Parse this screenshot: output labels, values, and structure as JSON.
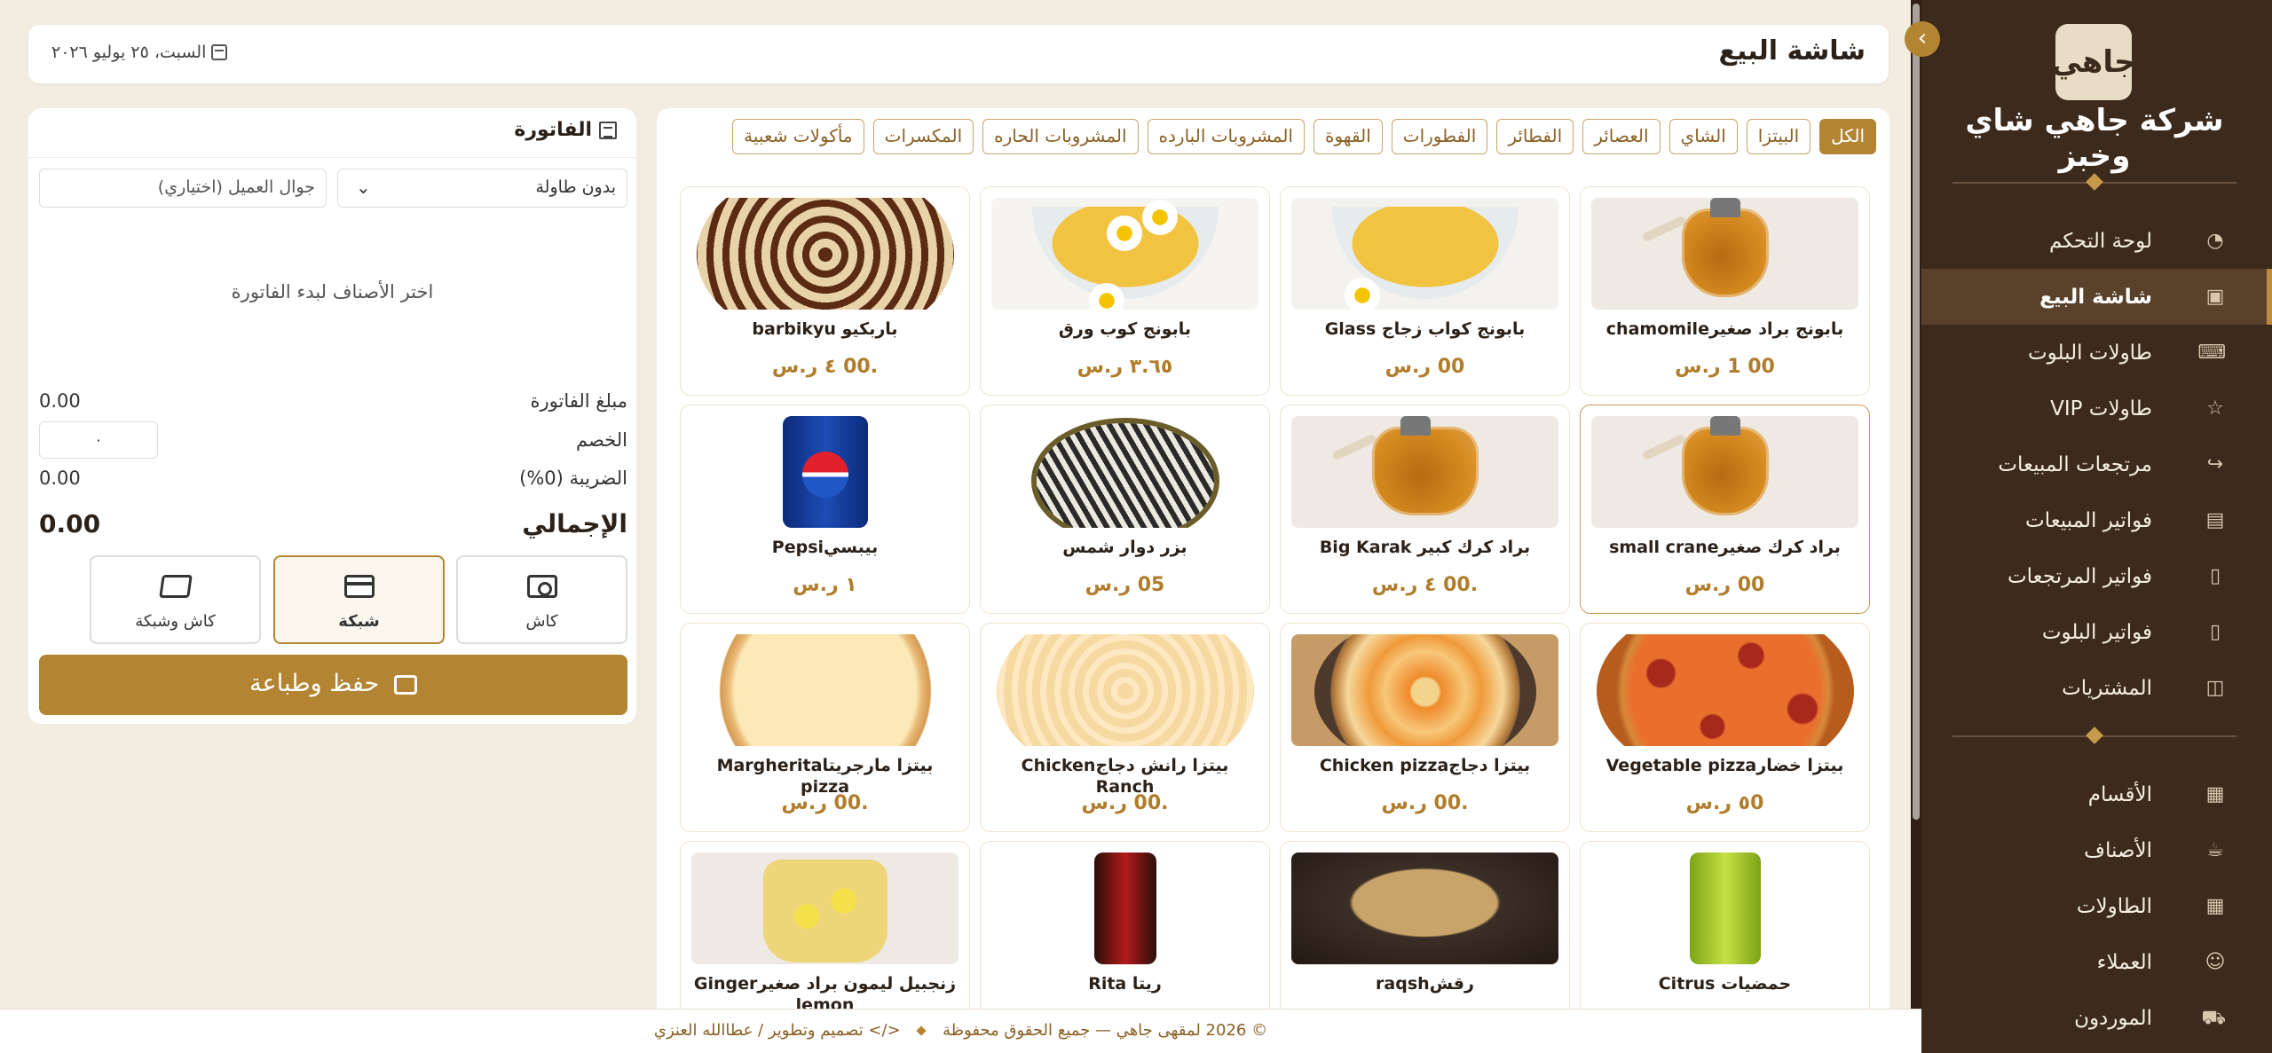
{
  "sidebar": {
    "logo_text": "جاهي",
    "company_name": "شركة جاهي شاي وخبز",
    "items": [
      {
        "label": "لوحة التحكم",
        "icon": "dashboard-gauge-icon"
      },
      {
        "label": "شاشة البيع",
        "icon": "pos-screen-icon",
        "active": true
      },
      {
        "label": "طاولات البلوت",
        "icon": "gamepad-icon"
      },
      {
        "label": "طاولات VIP",
        "icon": "star-icon"
      },
      {
        "label": "مرتجعات المبيعات",
        "icon": "return-arrow-icon"
      },
      {
        "label": "فواتير المبيعات",
        "icon": "invoice-icon"
      },
      {
        "label": "فواتير المرتجعات",
        "icon": "document-icon"
      },
      {
        "label": "فواتير البلوت",
        "icon": "document-list-icon"
      },
      {
        "label": "المشتريات",
        "icon": "shopping-bag-icon"
      }
    ],
    "items2": [
      {
        "label": "الأقسام",
        "icon": "grid-icon"
      },
      {
        "label": "الأصناف",
        "icon": "cup-icon"
      },
      {
        "label": "الطاولات",
        "icon": "tables-grid-icon"
      },
      {
        "label": "العملاء",
        "icon": "users-icon"
      },
      {
        "label": "الموردون",
        "icon": "truck-icon"
      }
    ]
  },
  "header": {
    "title": "شاشة البيع",
    "date": "السبت، ٢٥ يوليو ٢٠٢٦"
  },
  "categories": [
    "الكل",
    "البيتزا",
    "الشاي",
    "العصائر",
    "الفطائر",
    "الفطورات",
    "القهوة",
    "المشروبات البارده",
    "المشروبات الحاره",
    "المكسرات",
    "مأكولات شعبية"
  ],
  "active_category": "الكل",
  "products": [
    {
      "name": "بابونج براد صغيرchamomile",
      "price": "00   1 ر.س"
    },
    {
      "name": "بابونج كواب زجاج Glass",
      "price": "00   ر.س"
    },
    {
      "name": "بابونج كوب ورق",
      "price": "٣.٦٥ ر.س"
    },
    {
      "name": "باربكيو barbikyu",
      "price": ".00 ٤ ر.س"
    },
    {
      "name": "براد كرك صغيرsmall crane",
      "price": "00   ر.س"
    },
    {
      "name": "براد كرك كبير Big Karak",
      "price": ".00 ٤ ر.س"
    },
    {
      "name": "بزر دوار شمس",
      "price": "05   ر.س"
    },
    {
      "name": "بيبسيPepsi",
      "price": "١   ر.س"
    },
    {
      "name": "بيتزا خضارVegetable pizza",
      "price": "٥0   ر.س"
    },
    {
      "name": "بيتزا دجاجChicken pizza",
      "price": ".00   ر.س"
    },
    {
      "name": "بيتزا رانش دجاجChicken Ranch",
      "price": ".00   ر.س"
    },
    {
      "name": "بيتزا مارجريتاMargherita pizza",
      "price": ".00   ر.س"
    },
    {
      "name": "حمضيات Citrus",
      "price": ""
    },
    {
      "name": "رقشraqsh",
      "price": ""
    },
    {
      "name": "ريتا Rita",
      "price": ""
    },
    {
      "name": "زنجبيل ليمون براد صغيرGinger lemon",
      "price": ""
    }
  ],
  "invoice": {
    "title": "الفاتورة",
    "table_select": "بدون طاولة",
    "phone_placeholder": "جوال العميل (اختياري)",
    "empty_text": "اختر الأصناف لبدء الفاتورة",
    "subtotal_label": "مبلغ الفاتورة",
    "subtotal_value": "0.00",
    "discount_label": "الخصم",
    "discount_value": "٠",
    "tax_label": "الضريبة (0%)",
    "tax_value": "0.00",
    "total_label": "الإجمالي",
    "total_value": "0.00",
    "pay_cash": "كاش",
    "pay_card": "شبكة",
    "pay_mixed": "كاش وشبكة",
    "save_label": "حفظ وطباعة"
  },
  "footer": {
    "copyright": "© 2026 لمقهى جاهي — جميع الحقوق محفوظة",
    "credit": "</> تصميم وتطوير / عطاالله العنزي"
  },
  "colors": {
    "brand": "#b38432",
    "sidebar": "#3c2a1c",
    "background": "#f3ece0"
  }
}
